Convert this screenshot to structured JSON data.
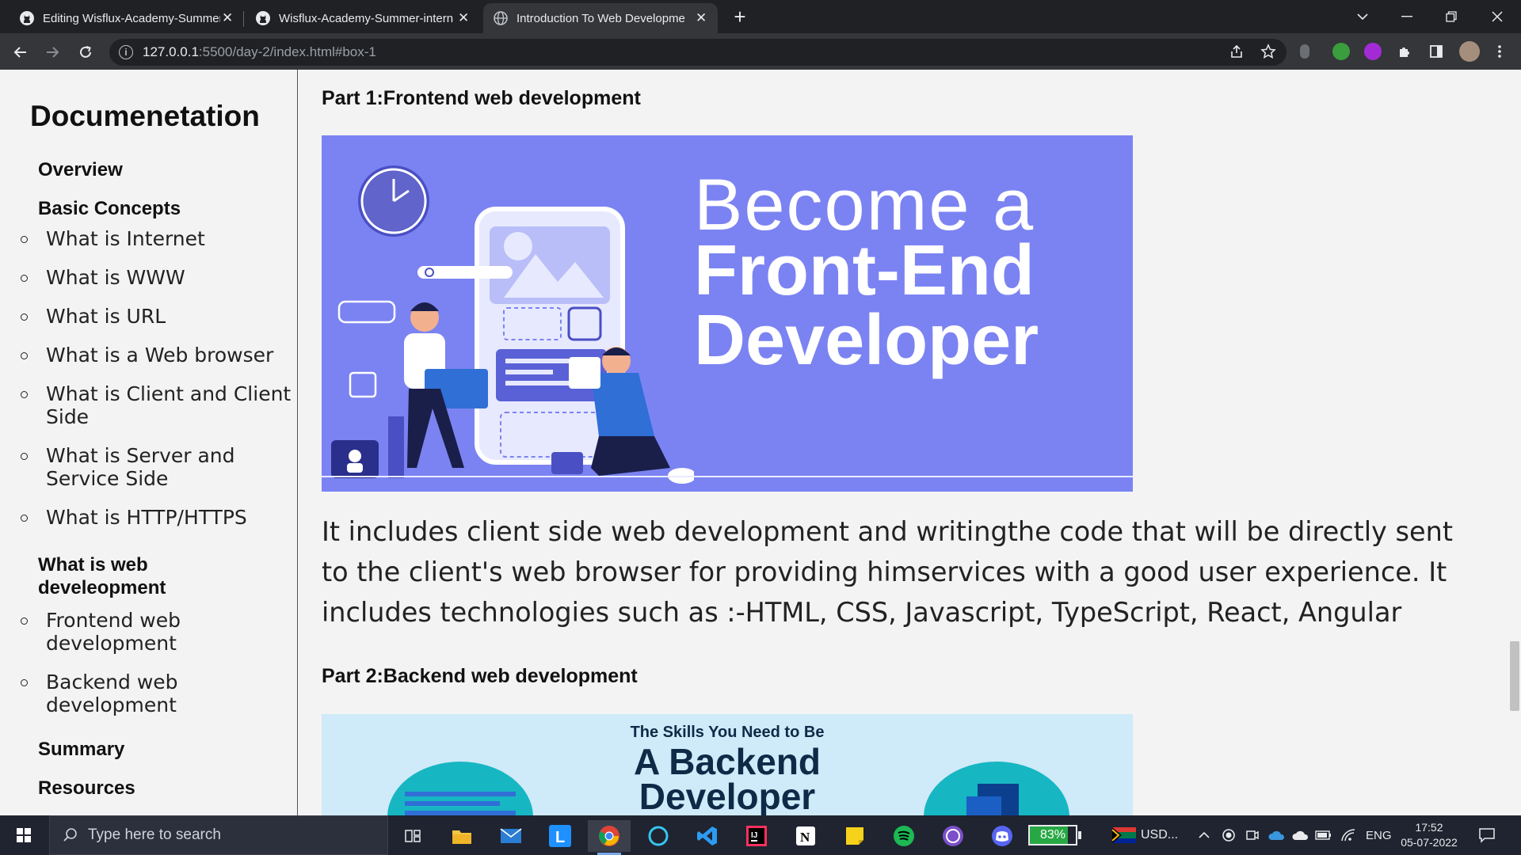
{
  "browser": {
    "tabs": [
      {
        "title": "Editing Wisflux-Academy-Summer",
        "close": "✕",
        "active": false
      },
      {
        "title": "Wisflux-Academy-Summer-intern",
        "close": "✕",
        "active": false
      },
      {
        "title": "Introduction To Web Developme",
        "close": "✕",
        "active": true
      }
    ],
    "new_tab": "+",
    "url_host": "127.0.0.1",
    "url_rest": ":5500/day-2/index.html#box-1"
  },
  "sidebar": {
    "title": "Documenetation",
    "overview": "Overview",
    "basic_concepts": "Basic Concepts",
    "basic_items": [
      "What is Internet",
      "What is WWW",
      "What is URL",
      "What is a Web browser",
      "What is Client and Client Side",
      "What is Server and Service Side",
      "What is HTTP/HTTPS"
    ],
    "web_dev": "What is web develeopment",
    "web_items": [
      "Frontend web development",
      "Backend web development"
    ],
    "summary": "Summary",
    "resources": "Resources"
  },
  "main": {
    "part1_title": "Part 1:Frontend web development",
    "banner1": {
      "line1": "Become a",
      "line2": "Front-End",
      "line3": "Developer"
    },
    "paragraph": "It includes client side web development and writingthe code that will be directly sent to the client's web browser for providing himservices with a good user experience. It includes technologies such as :-HTML, CSS, Javascript, TypeScript, React, Angular",
    "part2_title": "Part 2:Backend web development",
    "banner2": {
      "small": "The Skills You Need to Be",
      "line1": "A Backend",
      "line2": "Developer"
    }
  },
  "taskbar": {
    "search_placeholder": "Type here to search",
    "battery": "83%",
    "currency": "USD...",
    "lang": "ENG",
    "time": "17:52",
    "date": "05-07-2022"
  },
  "colors": {
    "banner1_bg": "#7b83f2",
    "banner2_bg": "#cfeaf8",
    "page_bg": "#f3f3f3"
  }
}
